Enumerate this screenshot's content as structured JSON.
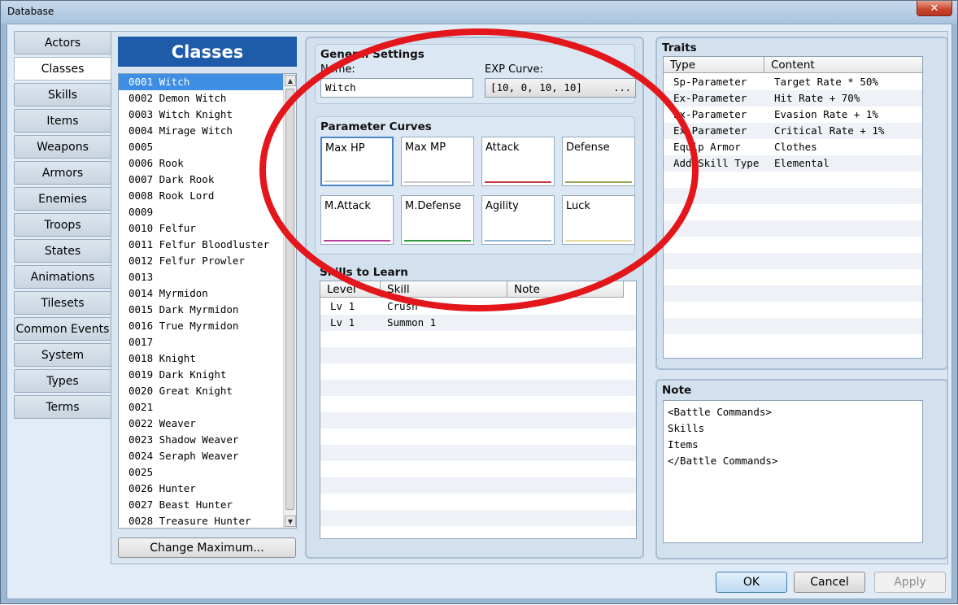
{
  "window": {
    "title": "Database",
    "close_glyph": "✕"
  },
  "nav": {
    "items": [
      {
        "label": "Actors"
      },
      {
        "label": "Classes",
        "active": true
      },
      {
        "label": "Skills"
      },
      {
        "label": "Items"
      },
      {
        "label": "Weapons"
      },
      {
        "label": "Armors"
      },
      {
        "label": "Enemies"
      },
      {
        "label": "Troops"
      },
      {
        "label": "States"
      },
      {
        "label": "Animations"
      },
      {
        "label": "Tilesets"
      },
      {
        "label": "Common Events"
      },
      {
        "label": "System"
      },
      {
        "label": "Types"
      },
      {
        "label": "Terms"
      }
    ]
  },
  "classes": {
    "header": "Classes",
    "selected_index": 0,
    "rows": [
      "0001 Witch",
      "0002 Demon Witch",
      "0003 Witch Knight",
      "0004 Mirage Witch",
      "0005",
      "0006 Rook",
      "0007 Dark Rook",
      "0008 Rook Lord",
      "0009",
      "0010 Felfur",
      "0011 Felfur Bloodluster",
      "0012 Felfur Prowler",
      "0013",
      "0014 Myrmidon",
      "0015 Dark Myrmidon",
      "0016 True Myrmidon",
      "0017",
      "0018 Knight",
      "0019 Dark Knight",
      "0020 Great Knight",
      "0021",
      "0022 Weaver",
      "0023 Shadow Weaver",
      "0024 Seraph Weaver",
      "0025",
      "0026 Hunter",
      "0027 Beast Hunter",
      "0028 Treasure Hunter"
    ],
    "change_max_label": "Change Maximum...",
    "scroll_up_glyph": "▲",
    "scroll_down_glyph": "▼"
  },
  "general": {
    "title": "General Settings",
    "name_label": "Name:",
    "name_value": "Witch",
    "exp_label": "EXP Curve:",
    "exp_value": "[10, 0, 10, 10]",
    "exp_button": "..."
  },
  "curves": {
    "title": "Parameter Curves",
    "items": [
      {
        "label": "Max HP",
        "color": "#c8c8c8"
      },
      {
        "label": "Max MP",
        "color": "#c8c8c8"
      },
      {
        "label": "Attack",
        "color": "#c0383f"
      },
      {
        "label": "Defense",
        "color": "#93a857"
      },
      {
        "label": "M.Attack",
        "color": "#b83ea0"
      },
      {
        "label": "M.Defense",
        "color": "#2e9a3c"
      },
      {
        "label": "Agility",
        "color": "#8fb6d1"
      },
      {
        "label": "Luck",
        "color": "#e6dc9a"
      }
    ]
  },
  "skills": {
    "title": "Skills to Learn",
    "columns": [
      "Level",
      "Skill",
      "Note"
    ],
    "rows": [
      {
        "level": "Lv  1",
        "skill": "Crush",
        "note": ""
      },
      {
        "level": "Lv  1",
        "skill": "Summon 1",
        "note": ""
      }
    ]
  },
  "traits": {
    "title": "Traits",
    "columns": [
      "Type",
      "Content"
    ],
    "rows": [
      {
        "type": "Sp-Parameter",
        "content": "Target Rate * 50%"
      },
      {
        "type": "Ex-Parameter",
        "content": "Hit Rate + 70%"
      },
      {
        "type": "Ex-Parameter",
        "content": "Evasion Rate + 1%"
      },
      {
        "type": "Ex-Parameter",
        "content": "Critical Rate + 1%"
      },
      {
        "type": "Equip Armor",
        "content": "Clothes"
      },
      {
        "type": "Add Skill Type",
        "content": "Elemental"
      }
    ]
  },
  "note": {
    "title": "Note",
    "lines": [
      "<Battle Commands>",
      "Skills",
      "Items",
      "</Battle Commands>"
    ]
  },
  "footer": {
    "ok": "OK",
    "cancel": "Cancel",
    "apply": "Apply"
  },
  "annotation": {
    "color": "#e3161c"
  }
}
